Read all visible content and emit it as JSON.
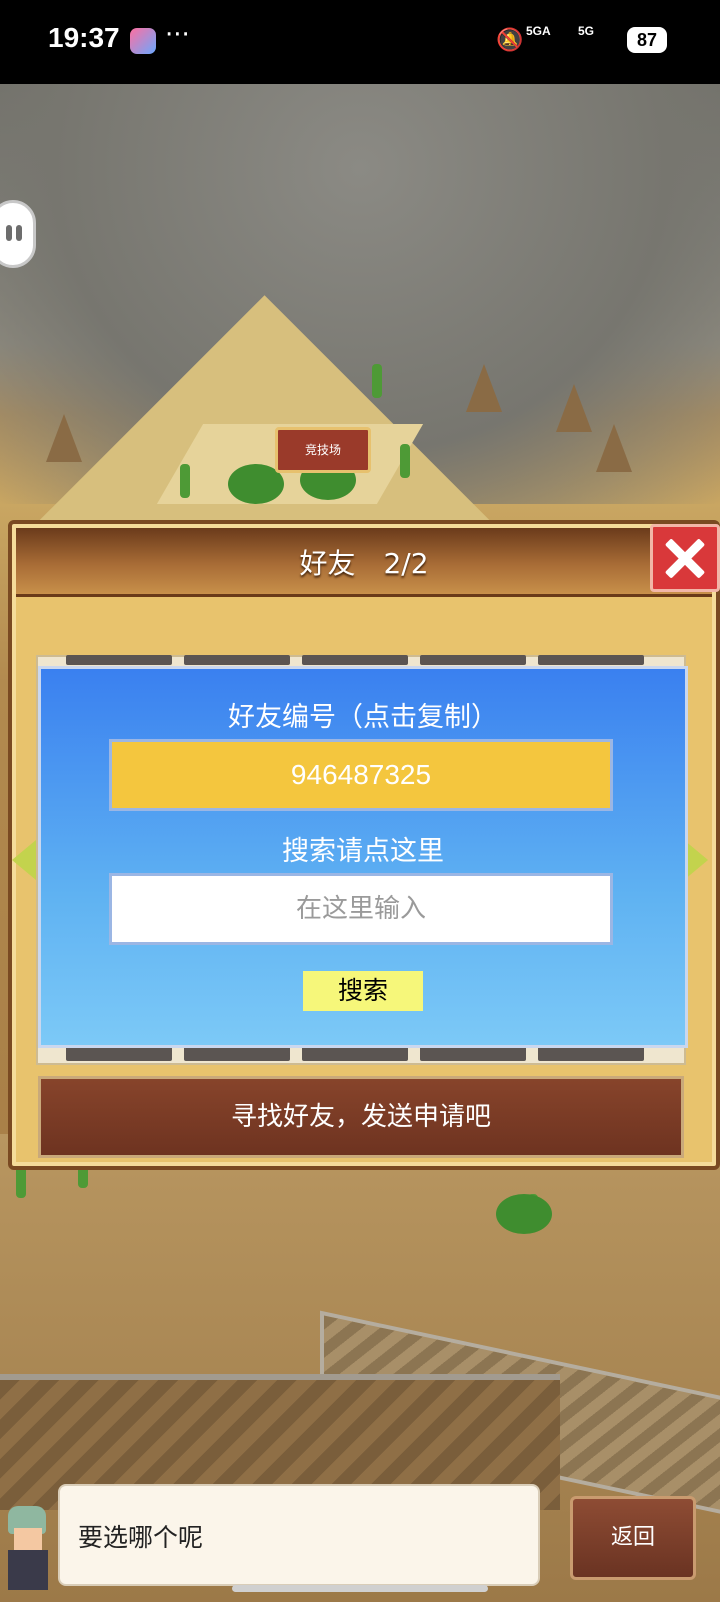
{
  "status_bar": {
    "time": "19:37",
    "more": "···",
    "signal1": "5GA",
    "signal2": "5G",
    "battery": "87"
  },
  "map": {
    "arena_sign": "竞技场"
  },
  "friends_panel": {
    "title": "好友　2/2",
    "friend_id_label": "好友编号（点击复制）",
    "friend_id_value": "946487325",
    "search_label": "搜索请点这里",
    "search_placeholder": "在这里输入",
    "search_button": "搜索",
    "footer_message": "寻找好友，发送申请吧"
  },
  "dialog": {
    "text": "要选哪个呢"
  },
  "back_button": "返回",
  "colors": {
    "panel_bg": "#e8c36d",
    "card_blue": "#3a80f0",
    "id_box": "#f4c63e",
    "search_btn": "#f6f77a",
    "close_red": "#d9383a"
  }
}
